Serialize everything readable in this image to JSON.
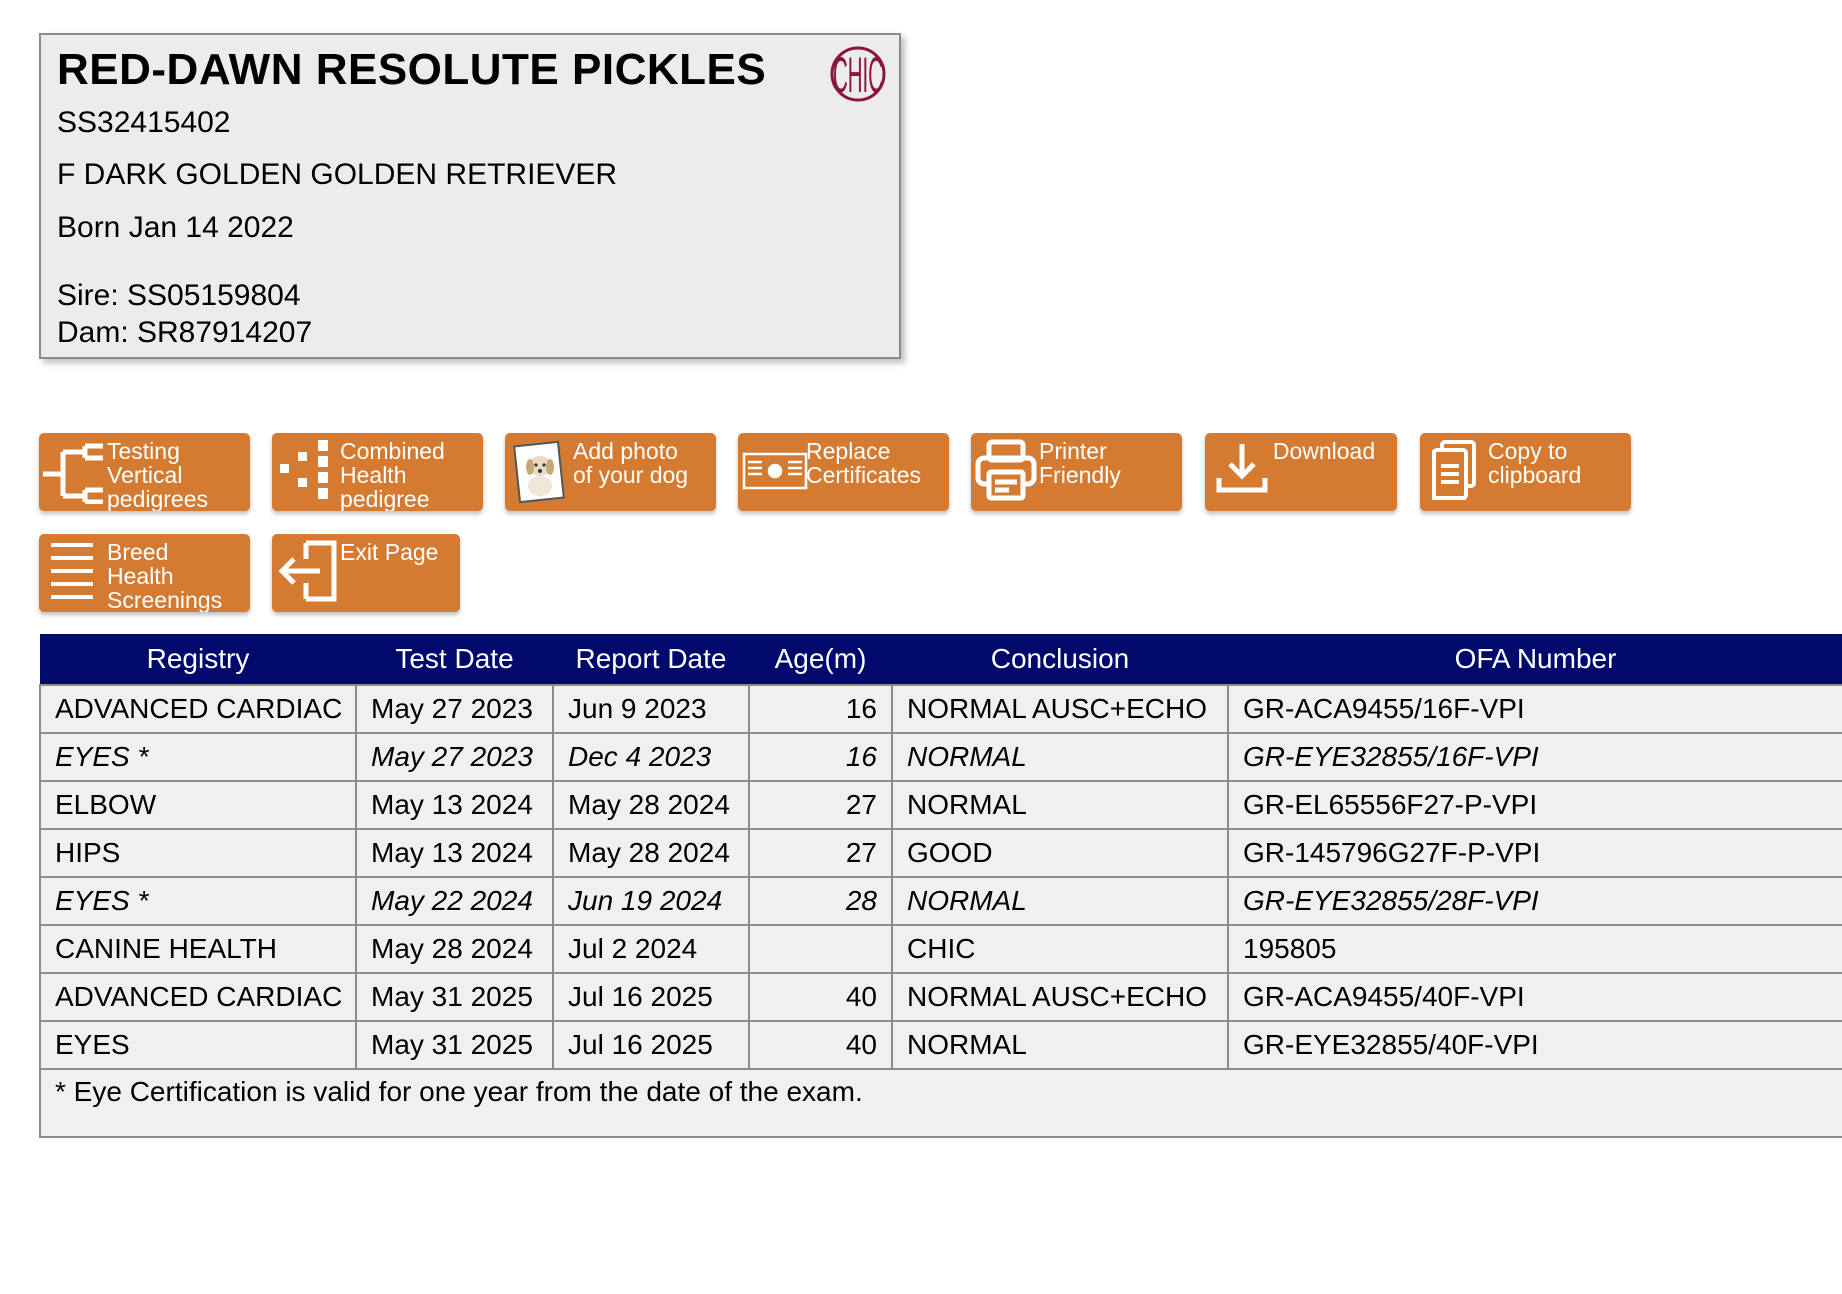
{
  "dog": {
    "name": "RED-DAWN RESOLUTE PICKLES",
    "registration": "SS32415402",
    "sex_color_breed": "F DARK GOLDEN GOLDEN RETRIEVER",
    "born": "Born Jan 14 2022",
    "sire": "Sire: SS05159804",
    "dam": "Dam: SR87914207",
    "badge_text": "CHIC",
    "badge_color": "#8a1538"
  },
  "toolbar": {
    "accent_color": "#d57a31",
    "buttons": [
      {
        "label": "Testing\nVertical\npedigrees",
        "icon": "vertical-pedigree-icon"
      },
      {
        "label": "Combined\nHealth\npedigree",
        "icon": "combined-pedigree-icon"
      },
      {
        "label": "Add photo\nof your dog",
        "icon": "dog-photo-icon"
      },
      {
        "label": "Replace\nCertificates",
        "icon": "certificate-icon"
      },
      {
        "label": "Printer\nFriendly",
        "icon": "printer-icon"
      },
      {
        "label": "Download",
        "icon": "download-icon"
      },
      {
        "label": "Copy to\nclipboard",
        "icon": "clipboard-icon"
      },
      {
        "label": "Breed\nHealth\nScreenings",
        "icon": "list-icon"
      },
      {
        "label": "Exit Page",
        "icon": "exit-icon"
      }
    ]
  },
  "results": {
    "header_color": "#000a6d",
    "columns": [
      "Registry",
      "Test Date",
      "Report Date",
      "Age(m)",
      "Conclusion",
      "OFA Number"
    ],
    "rows": [
      {
        "registry": "ADVANCED CARDIAC",
        "test_date": "May 27 2023",
        "report_date": "Jun 9 2023",
        "age": "16",
        "conclusion": "NORMAL AUSC+ECHO",
        "ofa_number": "GR-ACA9455/16F-VPI",
        "italic": false
      },
      {
        "registry": "EYES *",
        "test_date": "May 27 2023",
        "report_date": "Dec 4 2023",
        "age": "16",
        "conclusion": "NORMAL",
        "ofa_number": "GR-EYE32855/16F-VPI",
        "italic": true
      },
      {
        "registry": "ELBOW",
        "test_date": "May 13 2024",
        "report_date": "May 28 2024",
        "age": "27",
        "conclusion": "NORMAL",
        "ofa_number": "GR-EL65556F27-P-VPI",
        "italic": false
      },
      {
        "registry": "HIPS",
        "test_date": "May 13 2024",
        "report_date": "May 28 2024",
        "age": "27",
        "conclusion": "GOOD",
        "ofa_number": "GR-145796G27F-P-VPI",
        "italic": false
      },
      {
        "registry": "EYES *",
        "test_date": "May 22 2024",
        "report_date": "Jun 19 2024",
        "age": "28",
        "conclusion": "NORMAL",
        "ofa_number": "GR-EYE32855/28F-VPI",
        "italic": true
      },
      {
        "registry": "CANINE HEALTH",
        "test_date": "May 28 2024",
        "report_date": "Jul 2 2024",
        "age": "",
        "conclusion": "CHIC",
        "ofa_number": "195805",
        "italic": false
      },
      {
        "registry": "ADVANCED CARDIAC",
        "test_date": "May 31 2025",
        "report_date": "Jul 16 2025",
        "age": "40",
        "conclusion": "NORMAL AUSC+ECHO",
        "ofa_number": "GR-ACA9455/40F-VPI",
        "italic": false
      },
      {
        "registry": "EYES",
        "test_date": "May 31 2025",
        "report_date": "Jul 16 2025",
        "age": "40",
        "conclusion": "NORMAL",
        "ofa_number": "GR-EYE32855/40F-VPI",
        "italic": false
      }
    ],
    "footnote": "* Eye Certification is valid for one year from the date of the exam."
  }
}
